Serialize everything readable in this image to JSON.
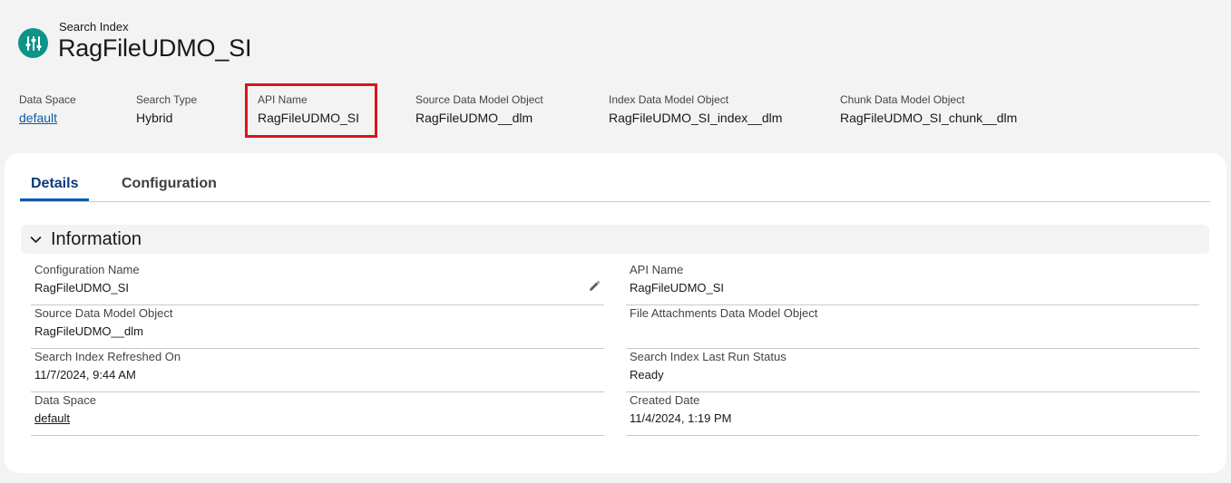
{
  "header": {
    "object_type": "Search Index",
    "title": "RagFileUDMO_SI",
    "icon": "sliders-icon",
    "fields": [
      {
        "label": "Data Space",
        "value": "default",
        "is_link": true
      },
      {
        "label": "Search Type",
        "value": "Hybrid"
      },
      {
        "label": "API Name",
        "value": "RagFileUDMO_SI"
      },
      {
        "label": "Source Data Model Object",
        "value": "RagFileUDMO__dlm"
      },
      {
        "label": "Index Data Model Object",
        "value": "RagFileUDMO_SI_index__dlm"
      },
      {
        "label": "Chunk Data Model Object",
        "value": "RagFileUDMO_SI_chunk__dlm"
      }
    ]
  },
  "tabs": [
    {
      "label": "Details",
      "active": true
    },
    {
      "label": "Configuration",
      "active": false
    }
  ],
  "section": {
    "title": "Information",
    "fields": {
      "configuration_name": {
        "label": "Configuration Name",
        "value": "RagFileUDMO_SI"
      },
      "api_name": {
        "label": "API Name",
        "value": "RagFileUDMO_SI"
      },
      "source_dmo": {
        "label": "Source Data Model Object",
        "value": "RagFileUDMO__dlm"
      },
      "file_attachments_dmo": {
        "label": "File Attachments Data Model Object",
        "value": ""
      },
      "refreshed_on": {
        "label": "Search Index Refreshed On",
        "value": "11/7/2024, 9:44 AM"
      },
      "last_run_status": {
        "label": "Search Index Last Run Status",
        "value": "Ready"
      },
      "data_space": {
        "label": "Data Space",
        "value": "default"
      },
      "created_date": {
        "label": "Created Date",
        "value": "11/4/2024, 1:19 PM"
      }
    }
  },
  "colors": {
    "icon_bg": "#0d9488",
    "link": "#0b5cab",
    "active_tab": "#0b3a7e",
    "highlight": "#d8161b"
  }
}
